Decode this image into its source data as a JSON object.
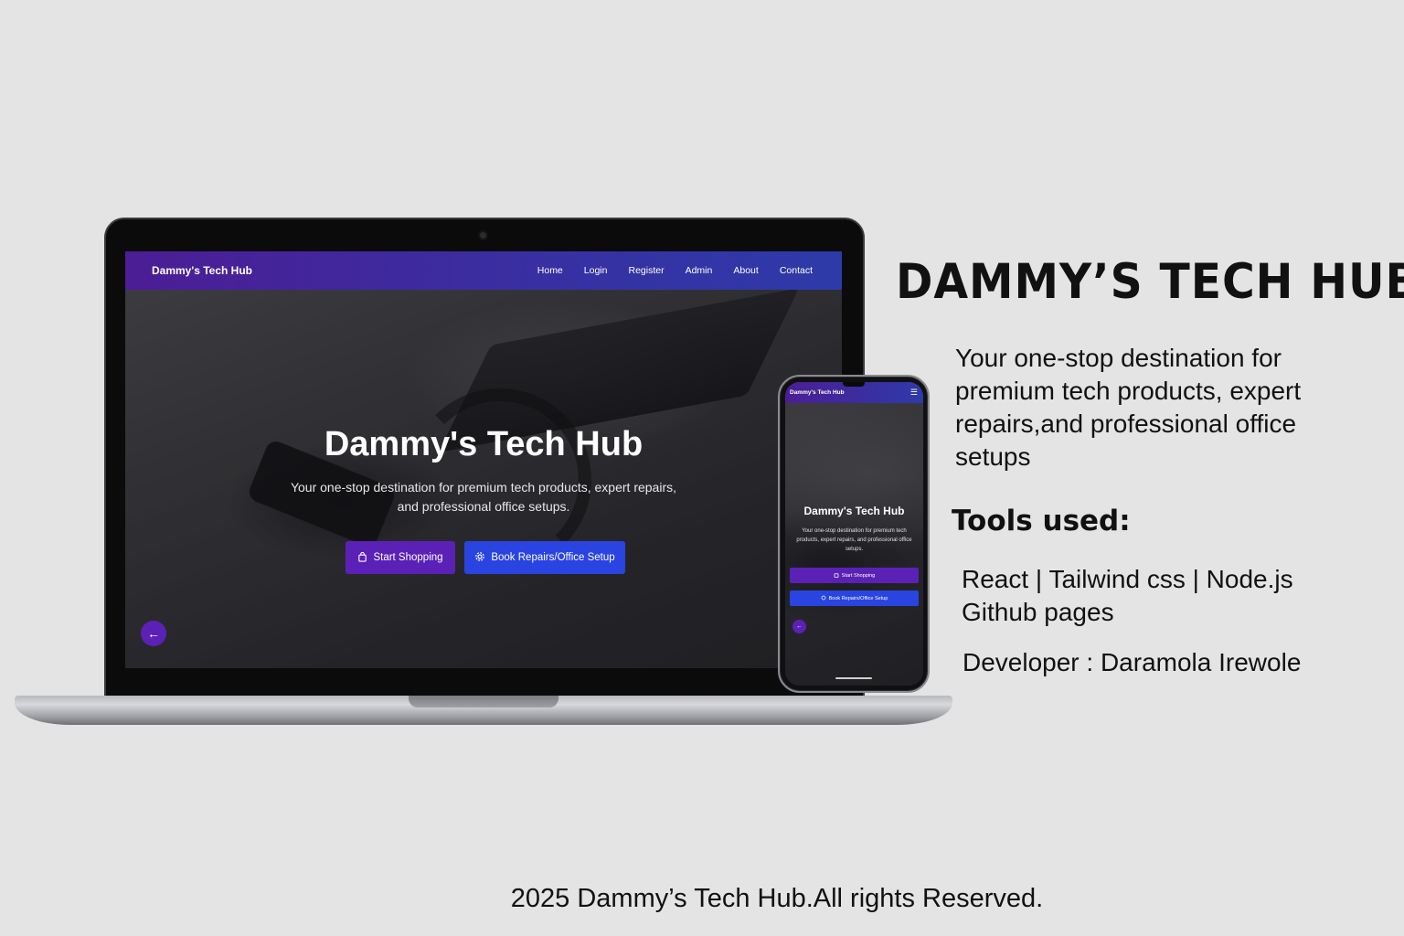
{
  "colors": {
    "background": "#e4e4e4",
    "nav_gradient_start": "#4c1d95",
    "nav_gradient_end": "#2e3aa8",
    "shop_button": "#5b21b6",
    "book_button": "#2944e0"
  },
  "laptop": {
    "nav": {
      "brand": "Dammy's Tech Hub",
      "links": [
        "Home",
        "Login",
        "Register",
        "Admin",
        "About",
        "Contact"
      ]
    },
    "hero": {
      "title": "Dammy's Tech Hub",
      "subtitle": "Your one-stop destination for premium tech products, expert repairs, and professional office setups.",
      "shop_button": "Start Shopping",
      "book_button": "Book Repairs/Office Setup",
      "shop_icon": "shopping-bag-icon",
      "book_icon": "gear-icon",
      "back_icon": "arrow-left-icon"
    }
  },
  "phone": {
    "nav": {
      "brand": "Dammy's Tech Hub",
      "menu_icon": "hamburger-icon"
    },
    "hero": {
      "title": "Dammy's Tech Hub",
      "subtitle": "Your one-stop destination for premium tech products, expert repairs, and professional office setups.",
      "shop_button": "Start Shopping",
      "book_button": "Book Repairs/Office Setup"
    }
  },
  "info": {
    "headline": "DAMMY’S TECH HUB",
    "description": "Your one-stop destination for premium tech products, expert repairs,and professional office setups",
    "tools_title": "Tools used:",
    "tools_line1": "React | Tailwind css | Node.js",
    "tools_line2": "Github pages",
    "developer": "Developer : Daramola Irewole"
  },
  "footer": "2025 Dammy’s Tech Hub.All rights Reserved."
}
